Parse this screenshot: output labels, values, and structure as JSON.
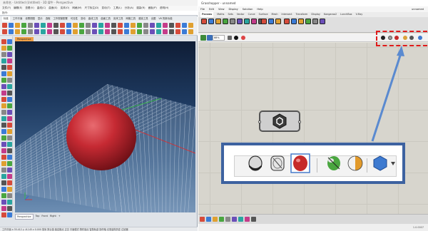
{
  "rhino": {
    "title": "未命名 - Untitled (Untitled) - 3D 犀牛 - Perspective",
    "menu": [
      "文件(F)",
      "编辑(E)",
      "查看(V)",
      "曲线(C)",
      "曲面(S)",
      "实体(O)",
      "网格(M)",
      "尺寸标注(D)",
      "变动(T)",
      "工具(L)",
      "分析(A)",
      "渲染(R)",
      "面板(P)",
      "说明(H)"
    ],
    "command_line": "指令:",
    "toolbar_tabs": [
      "标准",
      "工作平面",
      "设置视图",
      "显示",
      "选取",
      "工作视窗配置",
      "可见性",
      "变动",
      "曲线工具",
      "曲面工具",
      "实体工具",
      "网格工具",
      "渲染工具",
      "出图",
      "V6 的新功能"
    ],
    "viewport_label": "Perspective",
    "viewport_tabs": [
      "Perspective",
      "Top",
      "Front",
      "Right",
      "+"
    ],
    "status": "工作平面   x 35.412   y -6.145   z 0.000   毫米   默认值   锁定格点   正交   平面模式   物件锁点   智慧轨迹   操作轴   记录建构历史   过滤器"
  },
  "grasshopper": {
    "title": "Grasshopper - unnamed",
    "menu": [
      "File",
      "Edit",
      "View",
      "Display",
      "Solution",
      "Help"
    ],
    "document_name": "unnamed",
    "tabs": [
      "Params",
      "Maths",
      "Sets",
      "Vector",
      "Curve",
      "Surface",
      "Mesh",
      "Intersect",
      "Transform",
      "Display",
      "Kangaroo2",
      "LunchBox",
      "V-Ray"
    ],
    "zoom": "88%",
    "version": "1.0.0007"
  },
  "colors": {
    "highlight_red": "#e01a1a",
    "callout_blue": "#3d62a0",
    "arrow_blue": "#5a8ad0",
    "sphere_red": "#c62a33",
    "canvas_bg": "#d7d5cd",
    "viewport_label_bg": "#f0a048"
  },
  "callout_icons": [
    "wireframe-preview-icon",
    "no-preview-icon",
    "shaded-preview-icon",
    "preview-selected-only-icon",
    "document-preview-settings-icon",
    "preview-mesh-quality-icon"
  ]
}
